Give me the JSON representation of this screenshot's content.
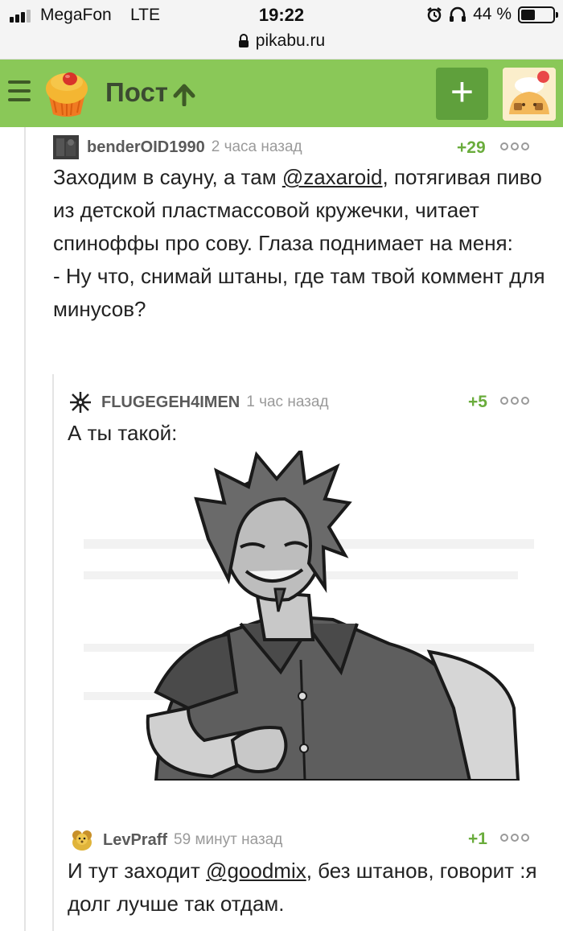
{
  "status_bar": {
    "carrier": "MegaFon",
    "network": "LTE",
    "time": "19:22",
    "battery_percent": "44 %",
    "battery_level": 0.44
  },
  "url_bar": {
    "url": "pikabu.ru"
  },
  "header": {
    "title": "Пост",
    "add_label": "+",
    "accent": "#8ac858"
  },
  "comments": [
    {
      "author": "benderOID1990",
      "time": "2 часа назад",
      "rating": "+29",
      "text_before": "Заходим в сауну, а там ",
      "mention": "@zaxaroid",
      "text_after": ", потягивая пиво из детской пластмассовой кружечки, читает спиноффы про сову. Глаза поднимает на меня:",
      "line2": "- Ну что, снимай штаны, где там твой коммент для минусов?"
    },
    {
      "author": "FLUGEGEH4IMEN",
      "time": "1 час назад",
      "rating": "+5",
      "text": "А ты такой:"
    },
    {
      "author": "LevPraff",
      "time": "59 минут назад",
      "rating": "+1",
      "text_before": "И тут заходит ",
      "mention": "@goodmix",
      "text_after": ", без штанов, говорит :я долг лучше так отдам."
    }
  ],
  "icons": {
    "menu": "hamburger-icon",
    "lock": "lock-icon",
    "alarm": "alarm-icon",
    "headphones": "headphones-icon",
    "up": "arrow-up-icon",
    "more": "more-dots-icon"
  }
}
